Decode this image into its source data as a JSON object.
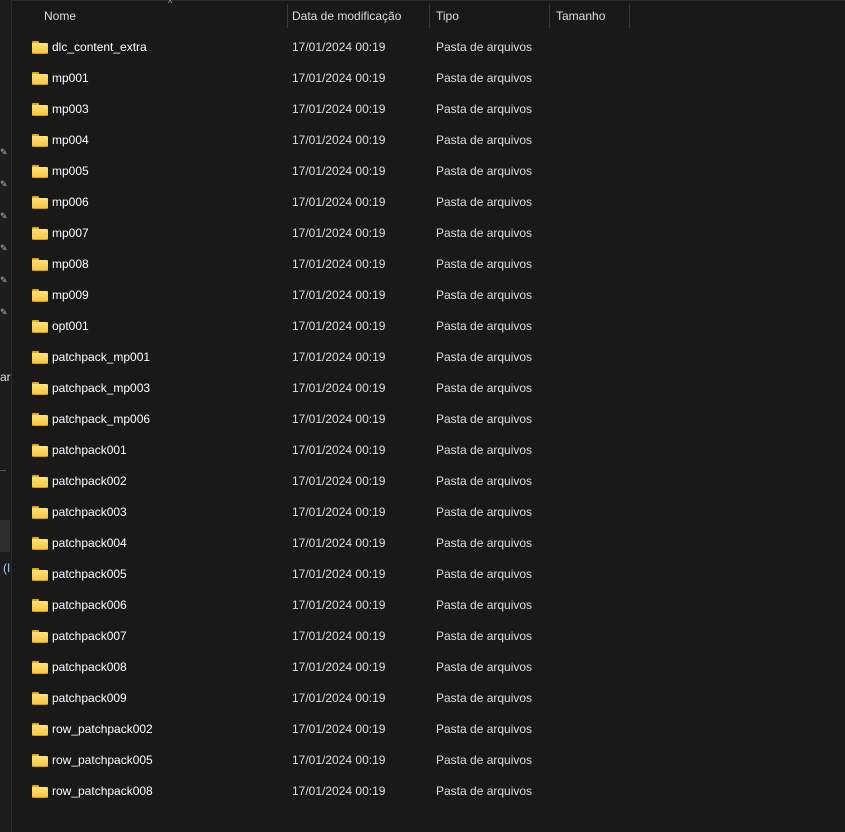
{
  "nav_pane": {
    "partial_text_1": "ar",
    "partial_text_2": "(I"
  },
  "columns": {
    "name": "Nome",
    "date": "Data de modificação",
    "type": "Tipo",
    "size": "Tamanho"
  },
  "files": [
    {
      "name": "dlc_content_extra",
      "date": "17/01/2024 00:19",
      "type": "Pasta de arquivos"
    },
    {
      "name": "mp001",
      "date": "17/01/2024 00:19",
      "type": "Pasta de arquivos"
    },
    {
      "name": "mp003",
      "date": "17/01/2024 00:19",
      "type": "Pasta de arquivos"
    },
    {
      "name": "mp004",
      "date": "17/01/2024 00:19",
      "type": "Pasta de arquivos"
    },
    {
      "name": "mp005",
      "date": "17/01/2024 00:19",
      "type": "Pasta de arquivos"
    },
    {
      "name": "mp006",
      "date": "17/01/2024 00:19",
      "type": "Pasta de arquivos"
    },
    {
      "name": "mp007",
      "date": "17/01/2024 00:19",
      "type": "Pasta de arquivos"
    },
    {
      "name": "mp008",
      "date": "17/01/2024 00:19",
      "type": "Pasta de arquivos"
    },
    {
      "name": "mp009",
      "date": "17/01/2024 00:19",
      "type": "Pasta de arquivos"
    },
    {
      "name": "opt001",
      "date": "17/01/2024 00:19",
      "type": "Pasta de arquivos"
    },
    {
      "name": "patchpack_mp001",
      "date": "17/01/2024 00:19",
      "type": "Pasta de arquivos"
    },
    {
      "name": "patchpack_mp003",
      "date": "17/01/2024 00:19",
      "type": "Pasta de arquivos"
    },
    {
      "name": "patchpack_mp006",
      "date": "17/01/2024 00:19",
      "type": "Pasta de arquivos"
    },
    {
      "name": "patchpack001",
      "date": "17/01/2024 00:19",
      "type": "Pasta de arquivos"
    },
    {
      "name": "patchpack002",
      "date": "17/01/2024 00:19",
      "type": "Pasta de arquivos"
    },
    {
      "name": "patchpack003",
      "date": "17/01/2024 00:19",
      "type": "Pasta de arquivos"
    },
    {
      "name": "patchpack004",
      "date": "17/01/2024 00:19",
      "type": "Pasta de arquivos"
    },
    {
      "name": "patchpack005",
      "date": "17/01/2024 00:19",
      "type": "Pasta de arquivos"
    },
    {
      "name": "patchpack006",
      "date": "17/01/2024 00:19",
      "type": "Pasta de arquivos"
    },
    {
      "name": "patchpack007",
      "date": "17/01/2024 00:19",
      "type": "Pasta de arquivos"
    },
    {
      "name": "patchpack008",
      "date": "17/01/2024 00:19",
      "type": "Pasta de arquivos"
    },
    {
      "name": "patchpack009",
      "date": "17/01/2024 00:19",
      "type": "Pasta de arquivos"
    },
    {
      "name": "row_patchpack002",
      "date": "17/01/2024 00:19",
      "type": "Pasta de arquivos"
    },
    {
      "name": "row_patchpack005",
      "date": "17/01/2024 00:19",
      "type": "Pasta de arquivos"
    },
    {
      "name": "row_patchpack008",
      "date": "17/01/2024 00:19",
      "type": "Pasta de arquivos"
    }
  ]
}
